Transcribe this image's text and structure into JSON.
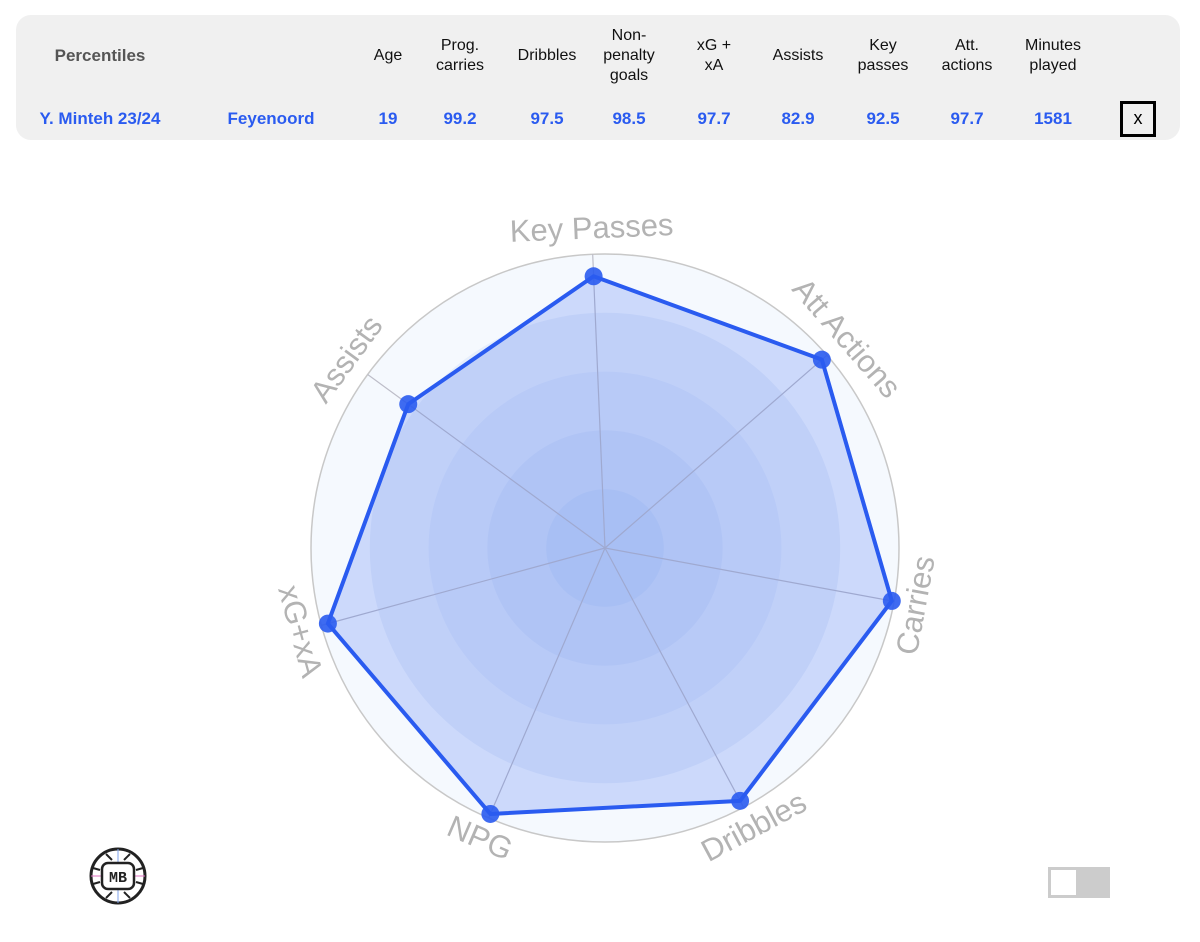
{
  "table": {
    "title": "Percentiles",
    "columns": [
      {
        "key": "age",
        "label": [
          "Age"
        ]
      },
      {
        "key": "prog_carries",
        "label": [
          "Prog.",
          "carries"
        ]
      },
      {
        "key": "dribbles",
        "label": [
          "Dribbles"
        ]
      },
      {
        "key": "npg",
        "label": [
          "Non-",
          "penalty",
          "goals"
        ]
      },
      {
        "key": "xg_xa",
        "label": [
          "xG +",
          "xA"
        ]
      },
      {
        "key": "assists",
        "label": [
          "Assists"
        ]
      },
      {
        "key": "key_passes",
        "label": [
          "Key",
          "passes"
        ]
      },
      {
        "key": "att_actions",
        "label": [
          "Att.",
          "actions"
        ]
      },
      {
        "key": "minutes",
        "label": [
          "Minutes",
          "played"
        ]
      }
    ],
    "row": {
      "player": "Y. Minteh 23/24",
      "team": "Feyenoord",
      "values": [
        "19",
        "99.2",
        "97.5",
        "98.5",
        "97.7",
        "82.9",
        "92.5",
        "97.7",
        "1581"
      ]
    },
    "close_label": "x"
  },
  "colors": {
    "accent": "#2a5bf0",
    "fill": "#a9c0f5",
    "label": "#b3b3b3",
    "grid": "#bdbdc8"
  },
  "logo": {
    "text": "MB"
  },
  "toggle": {
    "state": "off"
  },
  "chart_data": {
    "type": "radar",
    "title": "",
    "axes": [
      "Key Passes",
      "Att Actions",
      "Carries",
      "Dribbles",
      "NPG",
      "xG+xA",
      "Assists"
    ],
    "series": [
      {
        "name": "Y. Minteh 23/24",
        "values": [
          92.5,
          97.7,
          99.2,
          97.5,
          98.5,
          97.7,
          82.9
        ]
      }
    ],
    "range": [
      0,
      100
    ],
    "rings": 5,
    "grid": true,
    "legend": "none"
  }
}
